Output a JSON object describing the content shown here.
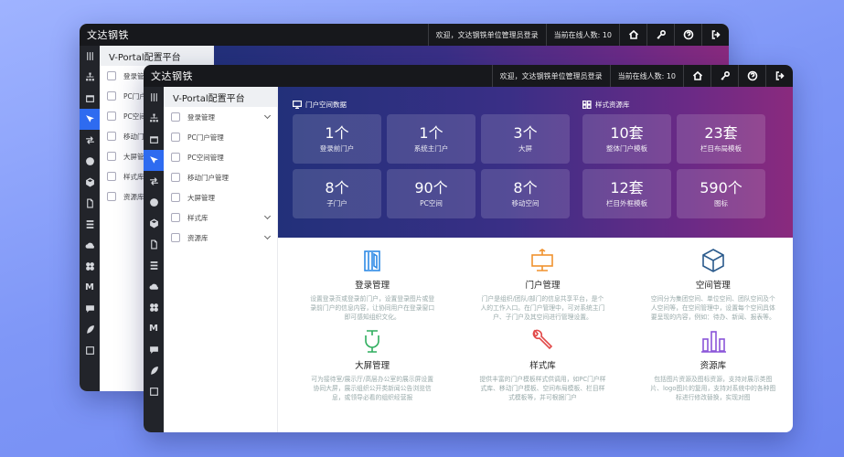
{
  "app": {
    "brand": "文达钢铁"
  },
  "topbar": {
    "welcome": "欢迎，文达钢铁单位管理员登录",
    "online": "当前在线人数: 10"
  },
  "icons": [
    "home-icon",
    "key-icon",
    "help-icon",
    "logout-icon"
  ],
  "rail": [
    "menu",
    "org",
    "calendar",
    "brush",
    "shuffle",
    "shield",
    "cube",
    "file",
    "list",
    "cloud",
    "flower",
    "M",
    "chat",
    "leaf",
    "export"
  ],
  "sidebar": {
    "title": "V-Portal配置平台",
    "items": [
      {
        "label": "登录管理",
        "expandable": true
      },
      {
        "label": "PC门户管理",
        "expandable": false
      },
      {
        "label": "PC空间管理",
        "expandable": false
      },
      {
        "label": "移动门户管理",
        "expandable": false
      },
      {
        "label": "大屏管理",
        "expandable": false
      },
      {
        "label": "样式库",
        "expandable": true
      },
      {
        "label": "资源库",
        "expandable": true
      }
    ]
  },
  "back_window": {
    "sidebar_items": [
      "登录管",
      "PC门户",
      "PC空间",
      "移动门户",
      "大屏管",
      "样式库",
      "资源库"
    ]
  },
  "hero": {
    "portal_title": "门户空间数据",
    "style_title": "样式资源库",
    "portal_stats": [
      {
        "value": "1个",
        "label": "登录前门户"
      },
      {
        "value": "1个",
        "label": "系统主门户"
      },
      {
        "value": "3个",
        "label": "大屏"
      },
      {
        "value": "8个",
        "label": "子门户"
      },
      {
        "value": "90个",
        "label": "PC空间"
      },
      {
        "value": "8个",
        "label": "移动空间"
      }
    ],
    "style_stats": [
      {
        "value": "10套",
        "label": "整体门户模板"
      },
      {
        "value": "23套",
        "label": "栏目布局模板"
      },
      {
        "value": "12套",
        "label": "栏目外框模板"
      },
      {
        "value": "590个",
        "label": "图标"
      }
    ]
  },
  "features": [
    {
      "title": "登录管理",
      "desc": "设置登录页或登录前门户，设置登录图片或登录前门户的信息内容，让协同用户在登录窗口即可感知组织文化。",
      "color": "#2e8ae6"
    },
    {
      "title": "门户管理",
      "desc": "门户是组织/团队/部门的信息共享平台，是个人的工作入口。在门户管理中，可对系统主门户、子门户及其空间进行管理设置。",
      "color": "#f0922e"
    },
    {
      "title": "空间管理",
      "desc": "空间分为集团空间、单位空间、团队空间及个人空间等，在空间管理中，设置每个空间具体要呈现的内容，例如：待办、新闻、报表等。",
      "color": "#2a5a8c"
    },
    {
      "title": "大屏管理",
      "desc": "可为接待室/展示厅/高层办公室的展示屏设置协同大屏，展示组织公开类新闻公告浏览信息，或领导必看的组织经营报",
      "color": "#2fae5e"
    },
    {
      "title": "样式库",
      "desc": "提供丰富的门户模板样式供调用，如PC门户样式库、移动门户模板、空间布局模板、栏目样式模板等，并可根据门户",
      "color": "#e24a4a"
    },
    {
      "title": "资源库",
      "desc": "包括图片资源及图标资源，支持对展示类图片、logo图片的复用，支持对系统中的各种图标进行修改替换，实现对图",
      "color": "#8a55d9"
    }
  ],
  "colors": {
    "accent": "#2e6bf0",
    "topbar": "#17181c",
    "rail": "#22242a"
  }
}
